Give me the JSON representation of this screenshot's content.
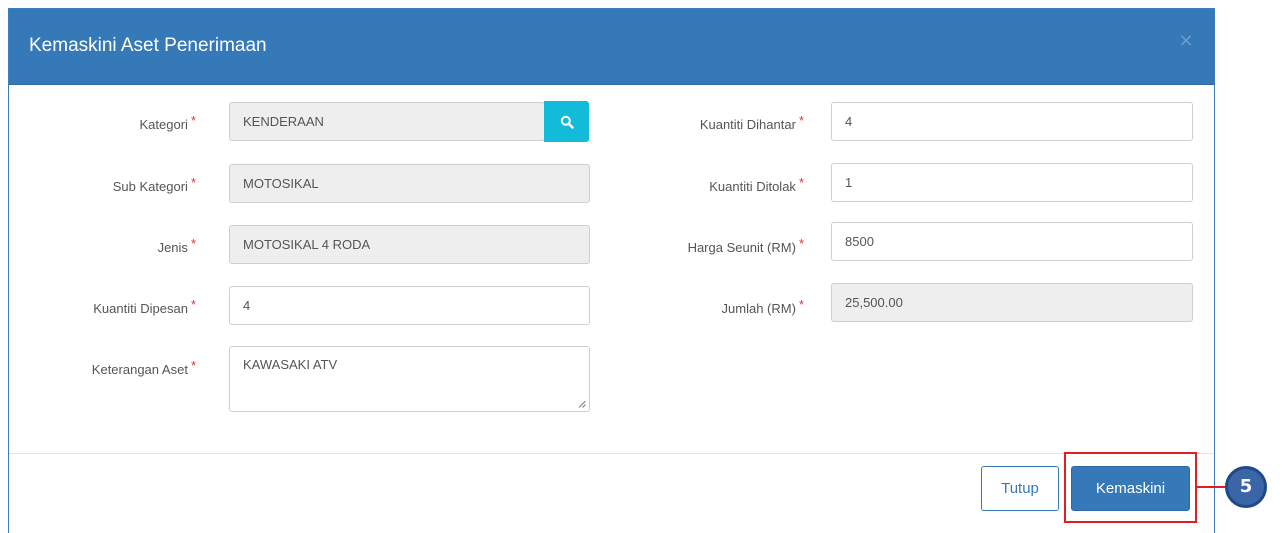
{
  "modal": {
    "title": "Kemaskini Aset Penerimaan",
    "close_label": "×"
  },
  "required_marker": "*",
  "left_fields": [
    {
      "label": "Kategori",
      "value": "KENDERAAN",
      "readonly": true
    },
    {
      "label": "Sub Kategori",
      "value": "MOTOSIKAL",
      "readonly": true
    },
    {
      "label": "Jenis",
      "value": "MOTOSIKAL 4 RODA",
      "readonly": true
    },
    {
      "label": "Kuantiti Dipesan",
      "value": "4",
      "readonly": false
    },
    {
      "label": "Keterangan Aset",
      "value": "KAWASAKI ATV",
      "readonly": false
    }
  ],
  "right_fields": [
    {
      "label": "Kuantiti Dihantar",
      "value": "4",
      "readonly": false
    },
    {
      "label": "Kuantiti Ditolak",
      "value": "1",
      "readonly": false
    },
    {
      "label": "Harga Seunit (RM)",
      "value": "8500",
      "readonly": false
    },
    {
      "label": "Jumlah (RM)",
      "value": "25,500.00",
      "readonly": true
    }
  ],
  "footer": {
    "tutup_label": "Tutup",
    "kemaskini_label": "Kemaskini"
  },
  "annotation": {
    "step_number": "5"
  },
  "colors": {
    "header": "#3579b8",
    "search_button": "#12bcd8",
    "required": "#e03131",
    "highlight": "#e02020",
    "badge": "#3a66a8"
  },
  "icons": {
    "search": "search-icon",
    "close": "close-icon"
  }
}
